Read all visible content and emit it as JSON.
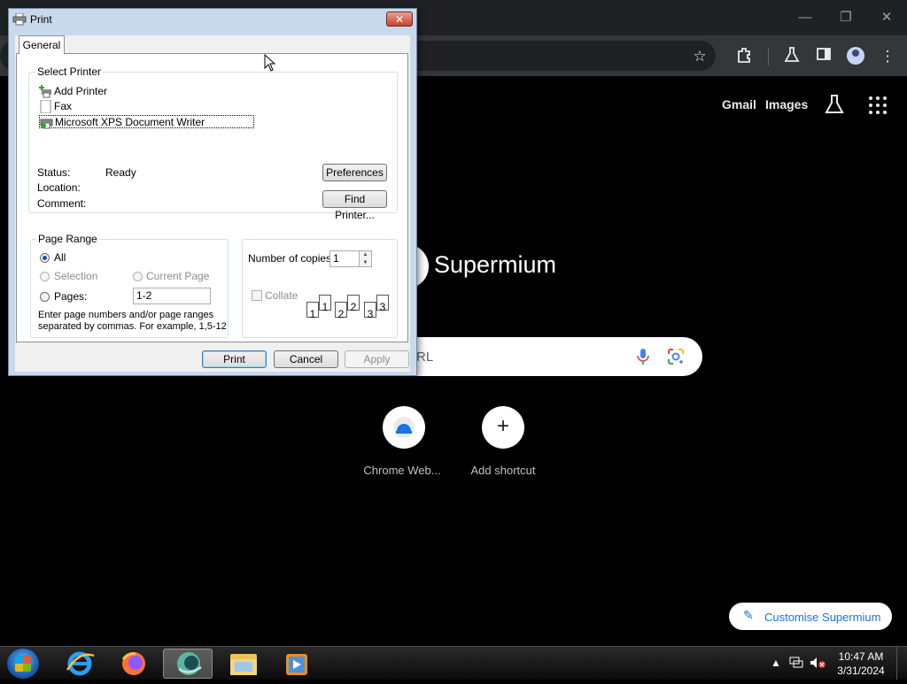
{
  "browser": {
    "window_controls": {
      "minimize": "—",
      "restore": "❐",
      "close": "✕"
    },
    "top_links": {
      "gmail": "Gmail",
      "images": "Images"
    },
    "brand_name": "Supermium",
    "search_placeholder": "RL",
    "shortcuts": [
      {
        "label": "Chrome Web..."
      },
      {
        "label": "Add shortcut",
        "icon": "+"
      }
    ],
    "customise_label": "Customise Supermium"
  },
  "dialog": {
    "title": "Print",
    "tab": "General",
    "select_printer": {
      "title": "Select Printer",
      "printers": [
        {
          "label": "Add Printer",
          "icon": "add-printer-icon"
        },
        {
          "label": "Fax",
          "icon": "fax-icon"
        },
        {
          "label": "Microsoft XPS Document Writer",
          "icon": "printer-icon",
          "selected": true
        }
      ],
      "status_label": "Status:",
      "status_value": "Ready",
      "location_label": "Location:",
      "comment_label": "Comment:",
      "preferences_button": "Preferences",
      "find_printer_button": "Find Printer..."
    },
    "page_range": {
      "title": "Page Range",
      "all": "All",
      "selection": "Selection",
      "current_page": "Current Page",
      "pages": "Pages:",
      "pages_value": "1-2",
      "hint_line1": "Enter page numbers and/or page ranges",
      "hint_line2": "separated by commas.  For example, 1,5-12"
    },
    "copies": {
      "label": "Number of copies:",
      "value": "1",
      "collate": "Collate",
      "collate_pages": [
        "1",
        "1",
        "2",
        "2",
        "3",
        "3"
      ]
    },
    "buttons": {
      "print": "Print",
      "cancel": "Cancel",
      "apply": "Apply"
    }
  },
  "taskbar": {
    "time": "10:47 AM",
    "date": "3/31/2024",
    "apps": [
      "internet-explorer",
      "firefox",
      "supermium",
      "file-explorer",
      "media-player"
    ]
  }
}
